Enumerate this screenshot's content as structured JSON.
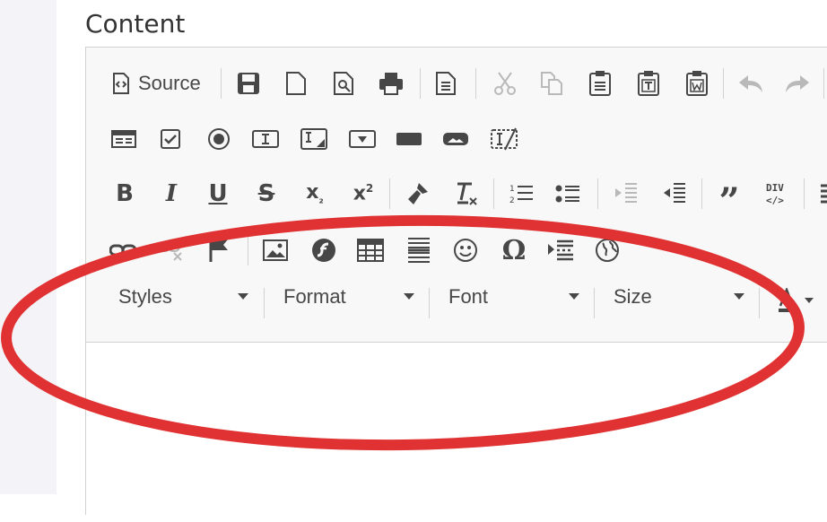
{
  "field": {
    "label": "Content"
  },
  "toolbar": {
    "source_label": "Source",
    "rows": [
      {
        "name": "document-tools",
        "icons": [
          "source-icon",
          "save-icon",
          "new-page-icon",
          "preview-icon",
          "print-icon",
          "templates-icon",
          "cut-icon",
          "copy-icon",
          "paste-icon",
          "paste-text-icon",
          "paste-word-icon",
          "undo-icon",
          "redo-icon"
        ]
      },
      {
        "name": "form-tools",
        "icons": [
          "form-icon",
          "checkbox-icon",
          "radio-icon",
          "text-field-icon",
          "textarea-icon",
          "select-icon",
          "button-icon",
          "image-button-icon",
          "hidden-field-icon"
        ]
      },
      {
        "name": "basic-styles",
        "icons": [
          "bold-icon",
          "italic-icon",
          "underline-icon",
          "strike-icon",
          "subscript-icon",
          "superscript-icon",
          "copy-format-icon",
          "remove-format-icon",
          "numbered-list-icon",
          "bulleted-list-icon",
          "outdent-icon",
          "indent-icon",
          "blockquote-icon",
          "div-icon"
        ]
      },
      {
        "name": "insert-tools",
        "icons": [
          "link-icon",
          "unlink-icon",
          "anchor-icon",
          "image-icon",
          "flash-icon",
          "table-icon",
          "horizontal-line-icon",
          "smiley-icon",
          "special-char-icon",
          "page-break-icon",
          "iframe-icon"
        ]
      }
    ],
    "combos": {
      "styles": "Styles",
      "format": "Format",
      "font": "Font",
      "size": "Size"
    }
  },
  "colors": {
    "annotation": "#e03232",
    "toolbar_bg": "#f8f8f8",
    "icon": "#474747",
    "border": "#d1d1d1"
  }
}
